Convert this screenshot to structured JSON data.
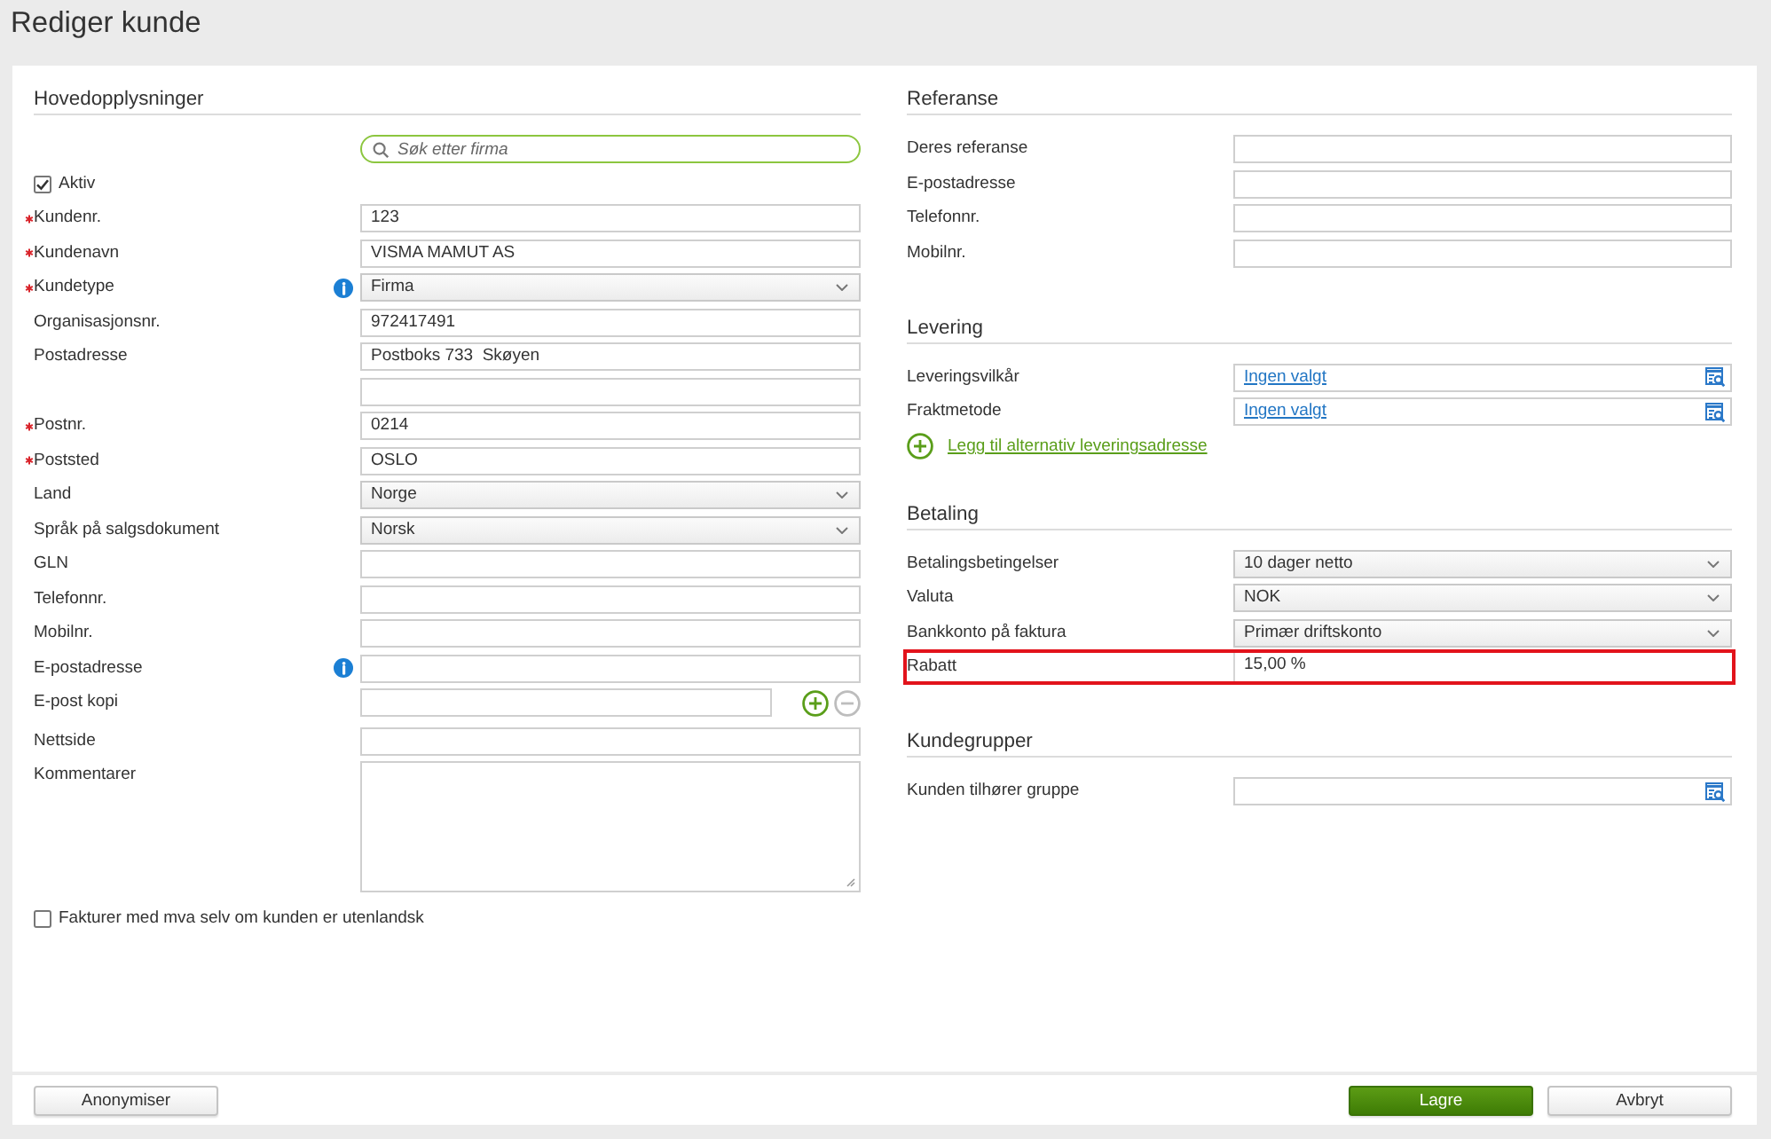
{
  "page": {
    "title": "Rediger kunde"
  },
  "columns": [
    {
      "sections": [
        {
          "title": "Hovedopplysninger",
          "rows": [
            {
              "kind": "search",
              "placeholder": "Søk etter firma"
            },
            {
              "kind": "checkbox",
              "label": "Aktiv",
              "checked": true
            },
            {
              "kind": "text",
              "label": "Kundenr.",
              "required": true,
              "info": false,
              "value": "123"
            },
            {
              "kind": "text",
              "label": "Kundenavn",
              "required": true,
              "info": false,
              "value": "VISMA MAMUT AS"
            },
            {
              "kind": "select",
              "label": "Kundetype",
              "required": true,
              "info": true,
              "value": "Firma"
            },
            {
              "kind": "text",
              "label": "Organisasjonsnr.",
              "required": false,
              "info": false,
              "value": "972417491"
            },
            {
              "kind": "text",
              "label": "Postadresse",
              "required": false,
              "info": false,
              "value": "Postboks 733  Skøyen"
            },
            {
              "kind": "text",
              "required": false,
              "info": false
            },
            {
              "kind": "text",
              "label": "Postnr.",
              "required": true,
              "info": false,
              "value": "0214"
            },
            {
              "kind": "text",
              "label": "Poststed",
              "required": true,
              "info": false,
              "value": "OSLO"
            },
            {
              "kind": "select",
              "label": "Land",
              "required": false,
              "info": false,
              "value": "Norge"
            },
            {
              "kind": "select",
              "label": "Språk på salgsdokument",
              "required": false,
              "info": false,
              "value": "Norsk"
            },
            {
              "kind": "text",
              "label": "GLN",
              "required": false,
              "info": false
            },
            {
              "kind": "text",
              "label": "Telefonnr.",
              "required": false,
              "info": false
            },
            {
              "kind": "text",
              "label": "Mobilnr.",
              "required": false,
              "info": false
            },
            {
              "kind": "text",
              "label": "E-postadresse",
              "required": false,
              "info": true
            },
            {
              "kind": "text_actions",
              "label": "E-post kopi",
              "required": false,
              "info": false,
              "actions": [
                {
                  "kind": "add",
                  "disabled": false
                },
                {
                  "kind": "remove",
                  "disabled": true
                }
              ]
            },
            {
              "kind": "text",
              "label": "Nettside",
              "required": false,
              "info": false
            },
            {
              "kind": "textarea",
              "label": "Kommentarer",
              "required": false,
              "info": false
            },
            {
              "kind": "checkbox",
              "label": "Fakturer med mva selv om kunden er utenlandsk",
              "checked": false
            }
          ]
        }
      ]
    },
    {
      "sections": [
        {
          "title": "Referanse",
          "rows": [
            {
              "kind": "text",
              "label": "Deres referanse"
            },
            {
              "kind": "text",
              "label": "E-postadresse"
            },
            {
              "kind": "text",
              "label": "Telefonnr."
            },
            {
              "kind": "text",
              "label": "Mobilnr."
            }
          ]
        },
        {
          "title": "Levering",
          "rows": [
            {
              "kind": "lookup",
              "label": "Leveringsvilkår",
              "value": "Ingen valgt"
            },
            {
              "kind": "lookup",
              "label": "Fraktmetode",
              "value": "Ingen valgt"
            },
            {
              "kind": "add_link",
              "label": "Legg til alternativ leveringsadresse"
            }
          ]
        },
        {
          "title": "Betaling",
          "rows": [
            {
              "kind": "select",
              "label": "Betalingsbetingelser",
              "value": "10 dager netto",
              "highlighted": false
            },
            {
              "kind": "select",
              "label": "Valuta",
              "value": "NOK",
              "highlighted": false
            },
            {
              "kind": "select",
              "label": "Bankkonto på faktura",
              "value": "Primær driftskonto",
              "highlighted": false
            },
            {
              "kind": "readonly",
              "label": "Rabatt",
              "value": "15,00 %",
              "highlighted": true
            }
          ]
        },
        {
          "title": "Kundegrupper",
          "rows": [
            {
              "kind": "lookup",
              "label": "Kunden tilhører gruppe"
            }
          ]
        }
      ]
    }
  ],
  "footer": {
    "left": [
      {
        "label": "Anonymiser",
        "kind": "secondary"
      }
    ],
    "right": [
      {
        "label": "Lagre",
        "kind": "primary"
      },
      {
        "label": "Avbryt",
        "kind": "secondary"
      }
    ]
  }
}
